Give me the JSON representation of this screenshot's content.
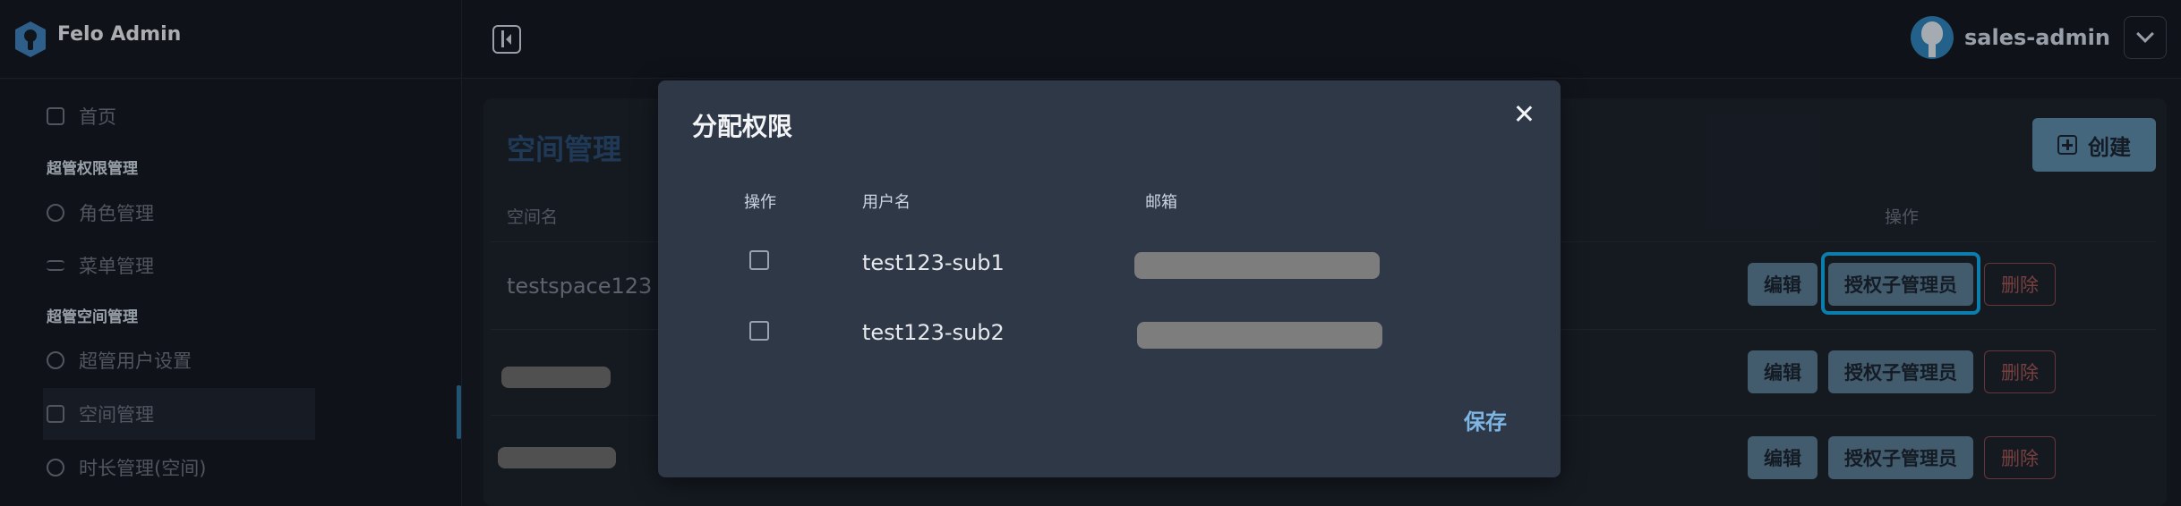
{
  "app": {
    "name": "Felo Admin",
    "username": "sales-admin"
  },
  "sidebar": {
    "items": [
      {
        "label": "首页",
        "icon": "home-icon"
      },
      {
        "group": "超管权限管理"
      },
      {
        "label": "角色管理",
        "icon": "user-icon"
      },
      {
        "label": "菜单管理",
        "icon": "menu-icon"
      },
      {
        "group": "超管空间管理"
      },
      {
        "label": "超管用户设置",
        "icon": "user-icon"
      },
      {
        "label": "空间管理",
        "icon": "folder-icon"
      },
      {
        "label": "时长管理(空间)",
        "icon": "clock-icon"
      }
    ]
  },
  "main": {
    "title": "空间管理",
    "create_label": "创建",
    "columns": {
      "space_name": "空间名",
      "actions": "操作"
    },
    "rows": [
      {
        "space_name": "testspace123"
      },
      {
        "space_name": ""
      },
      {
        "space_name": ""
      }
    ],
    "row_actions": {
      "edit": "编辑",
      "grant": "授权子管理员",
      "delete": "删除"
    }
  },
  "modal": {
    "title": "分配权限",
    "headers": {
      "action": "操作",
      "username": "用户名",
      "email": "邮箱"
    },
    "rows": [
      {
        "username": "test123-sub1",
        "checked": false
      },
      {
        "username": "test123-sub2",
        "checked": false
      }
    ],
    "save_label": "保存"
  },
  "colors": {
    "accent": "#10a8e8",
    "primary_button": "#587a92",
    "danger": "#a15555",
    "link": "#7db6e4"
  }
}
